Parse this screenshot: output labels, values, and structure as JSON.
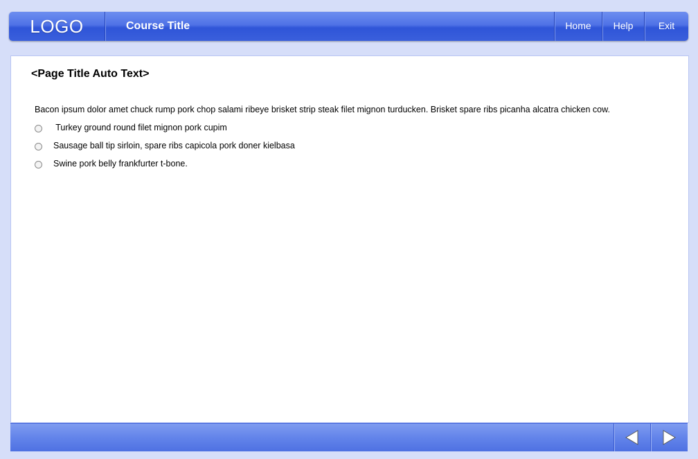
{
  "header": {
    "logo": "LOGO",
    "course_title": "Course Title",
    "nav": {
      "home": "Home",
      "help": "Help",
      "exit": "Exit"
    }
  },
  "page": {
    "title": "<Page Title Auto Text>",
    "intro": "Bacon ipsum dolor amet chuck rump pork chop salami ribeye brisket strip steak filet mignon turducken. Brisket spare ribs picanha alcatra chicken cow.",
    "options": [
      " Turkey ground round filet mignon pork cupim",
      "Sausage ball tip sirloin, spare ribs capicola pork doner kielbasa",
      "Swine pork belly frankfurter t-bone."
    ]
  },
  "footer": {
    "back_icon": "triangle-left-icon",
    "next_icon": "triangle-right-icon"
  },
  "colors": {
    "background": "#d6def9",
    "header_blue": "#3a5fdc",
    "footer_blue": "#6384ea"
  }
}
